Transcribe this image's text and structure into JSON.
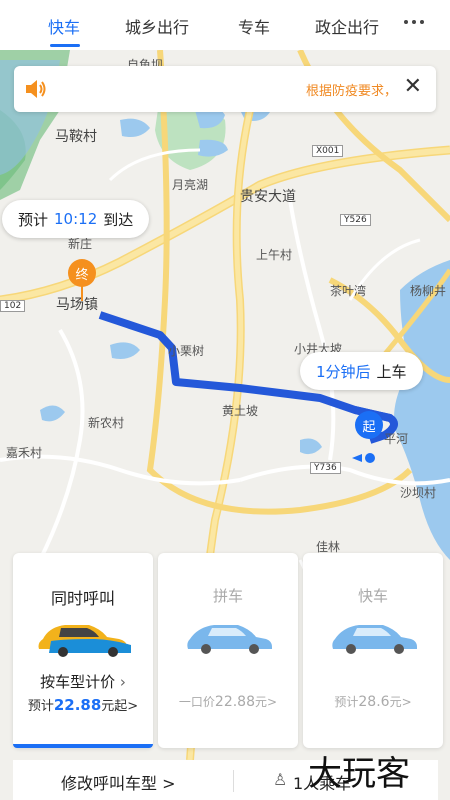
{
  "tabs": [
    "快车",
    "城乡出行",
    "专车",
    "政企出行"
  ],
  "active_tab": "快车",
  "notice": {
    "text": "根据防疫要求，",
    "close": "✕"
  },
  "eta_bubble": {
    "prefix": "预计",
    "time": "10:12",
    "suffix": "到达"
  },
  "pickup_bubble": {
    "time": "1分钟后",
    "suffix": "上车"
  },
  "pins": {
    "end": "终",
    "start": "起"
  },
  "map_labels": [
    "自鱼坝",
    "马鞍村",
    "月亮湖",
    "贵安大道",
    "X001",
    "Y526",
    "新庄",
    "马场镇",
    "上午村",
    "茶叶湾",
    "杨柳井",
    "小栗树",
    "小井大坡",
    "黄土坡",
    "新农村",
    "嘉禾村",
    "平河",
    "Y736",
    "沙坝村",
    "佳林",
    "102"
  ],
  "cards": {
    "call_all": {
      "title": "同时呼叫",
      "sub": "按车型计价",
      "price_prefix": "预计",
      "price": "22.88",
      "price_suffix": "元起>"
    },
    "carpool": {
      "title": "拼车",
      "price_prefix": "一口价",
      "price": "22.88",
      "price_suffix": "元>"
    },
    "express": {
      "title": "快车",
      "price_prefix": "预计",
      "price": "28.6",
      "price_suffix": "元>"
    }
  },
  "bottom_bar": {
    "left": "修改呼叫车型 >",
    "right": "1人乘车"
  },
  "watermark": "大玩客"
}
